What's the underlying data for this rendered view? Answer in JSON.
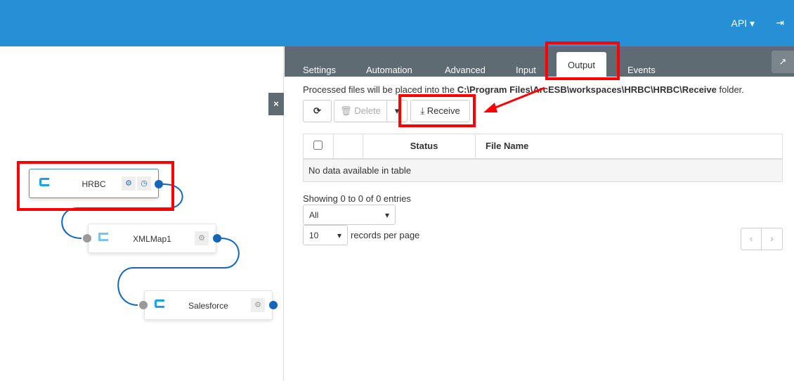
{
  "header": {
    "api_menu": "API ▾",
    "logout_icon": "⇥"
  },
  "flow": {
    "close": "×",
    "nodes": [
      {
        "label": "HRBC"
      },
      {
        "label": "XMLMap1"
      },
      {
        "label": "Salesforce"
      }
    ]
  },
  "tabs": [
    "Settings",
    "Automation",
    "Advanced",
    "Input",
    "Output",
    "Events"
  ],
  "output": {
    "info_prefix": "Processed files will be placed into the ",
    "info_path": "C:\\Program Files\\ArcESB\\workspaces\\HRBC\\HRBC\\Receive",
    "info_suffix": " folder.",
    "refresh": "⟳",
    "delete": "Delete",
    "receive": "Receive",
    "columns": [
      "Status",
      "File Name"
    ],
    "empty": "No data available in table",
    "showing": "Showing 0 to 0 of 0 entries",
    "filter": "All",
    "page_size": "10",
    "per_page": "records per page",
    "prev": "‹",
    "next": "›"
  }
}
